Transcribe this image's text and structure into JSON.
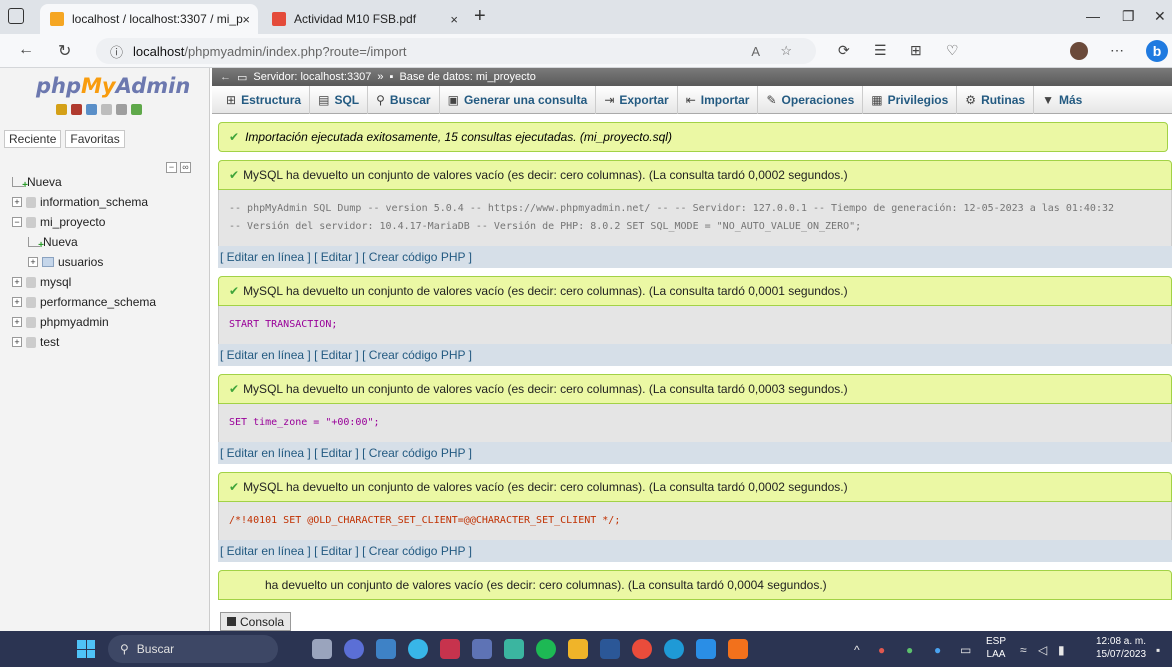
{
  "browser": {
    "tabs": [
      {
        "title": "localhost / localhost:3307 / mi_p",
        "close": "×"
      },
      {
        "title": "Actividad M10 FSB.pdf",
        "close": "×"
      }
    ],
    "newtab": "+",
    "url_host": "localhost",
    "url_path": "/phpmyadmin/index.php?route=/import"
  },
  "sidebar": {
    "logo_php": "php",
    "logo_my": "My",
    "logo_admin": "Admin",
    "tabs": [
      "Reciente",
      "Favoritas"
    ],
    "tree": [
      {
        "label": "Nueva",
        "type": "new",
        "indent": 0
      },
      {
        "label": "information_schema",
        "type": "db",
        "indent": 0
      },
      {
        "label": "mi_proyecto",
        "type": "db-open",
        "indent": 0
      },
      {
        "label": "Nueva",
        "type": "new",
        "indent": 1
      },
      {
        "label": "usuarios",
        "type": "table",
        "indent": 1
      },
      {
        "label": "mysql",
        "type": "db",
        "indent": 0
      },
      {
        "label": "performance_schema",
        "type": "db",
        "indent": 0
      },
      {
        "label": "phpmyadmin",
        "type": "db",
        "indent": 0
      },
      {
        "label": "test",
        "type": "db",
        "indent": 0
      }
    ]
  },
  "header": {
    "server": "Servidor: localhost:3307",
    "sep": "»",
    "database": "Base de datos: mi_proyecto"
  },
  "menu": {
    "tabs": [
      {
        "label": "Estructura",
        "icon": "structure-icon",
        "glyph": "⊞"
      },
      {
        "label": "SQL",
        "icon": "sql-icon",
        "glyph": "▤"
      },
      {
        "label": "Buscar",
        "icon": "search-icon",
        "glyph": "⚲"
      },
      {
        "label": "Generar una consulta",
        "icon": "query-icon",
        "glyph": "▣"
      },
      {
        "label": "Exportar",
        "icon": "export-icon",
        "glyph": "⇥"
      },
      {
        "label": "Importar",
        "icon": "import-icon",
        "glyph": "⇤"
      },
      {
        "label": "Operaciones",
        "icon": "wrench-icon",
        "glyph": "✎"
      },
      {
        "label": "Privilegios",
        "icon": "privileges-icon",
        "glyph": "▦"
      },
      {
        "label": "Rutinas",
        "icon": "routines-icon",
        "glyph": "⚙"
      },
      {
        "label": "Más",
        "icon": "more-icon",
        "glyph": "▼"
      }
    ]
  },
  "import_message": "Importación ejecutada exitosamente, 15 consultas ejecutadas. (mi_proyecto.sql)",
  "results": [
    {
      "message": "MySQL ha devuelto un conjunto de valores vacío (es decir: cero columnas). (La consulta tardó 0,0002 segundos.)",
      "sql_line1": "-- phpMyAdmin SQL Dump -- version 5.0.4 -- https://www.phpmyadmin.net/ -- -- Servidor: 127.0.0.1 -- Tiempo de generación: 12-05-2023 a las 01:40:32",
      "sql_line2": "-- Versión del servidor: 10.4.17-MariaDB -- Versión de PHP: 8.0.2 SET SQL_MODE = \"NO_AUTO_VALUE_ON_ZERO\";"
    },
    {
      "message": "MySQL ha devuelto un conjunto de valores vacío (es decir: cero columnas). (La consulta tardó 0,0001 segundos.)",
      "sql_line1": "START TRANSACTION;"
    },
    {
      "message": "MySQL ha devuelto un conjunto de valores vacío (es decir: cero columnas). (La consulta tardó 0,0003 segundos.)",
      "sql_line1": "SET time_zone = \"+00:00\";"
    },
    {
      "message": "MySQL ha devuelto un conjunto de valores vacío (es decir: cero columnas). (La consulta tardó 0,0002 segundos.)",
      "sql_line1": "/*!40101 SET @OLD_CHARACTER_SET_CLIENT=@@CHARACTER_SET_CLIENT */;"
    },
    {
      "message": "ha devuelto un conjunto de valores vacío (es decir: cero columnas). (La consulta tardó 0,0004 segundos.)"
    }
  ],
  "links": {
    "edit_inline": "[ Editar en línea ]",
    "edit": "[ Editar ]",
    "php": "[ Crear código PHP ]"
  },
  "console": "Consola",
  "taskbar": {
    "search": "Buscar",
    "lang1": "ESP",
    "lang2": "LAA",
    "time": "12:08 a. m.",
    "date": "15/07/2023"
  }
}
